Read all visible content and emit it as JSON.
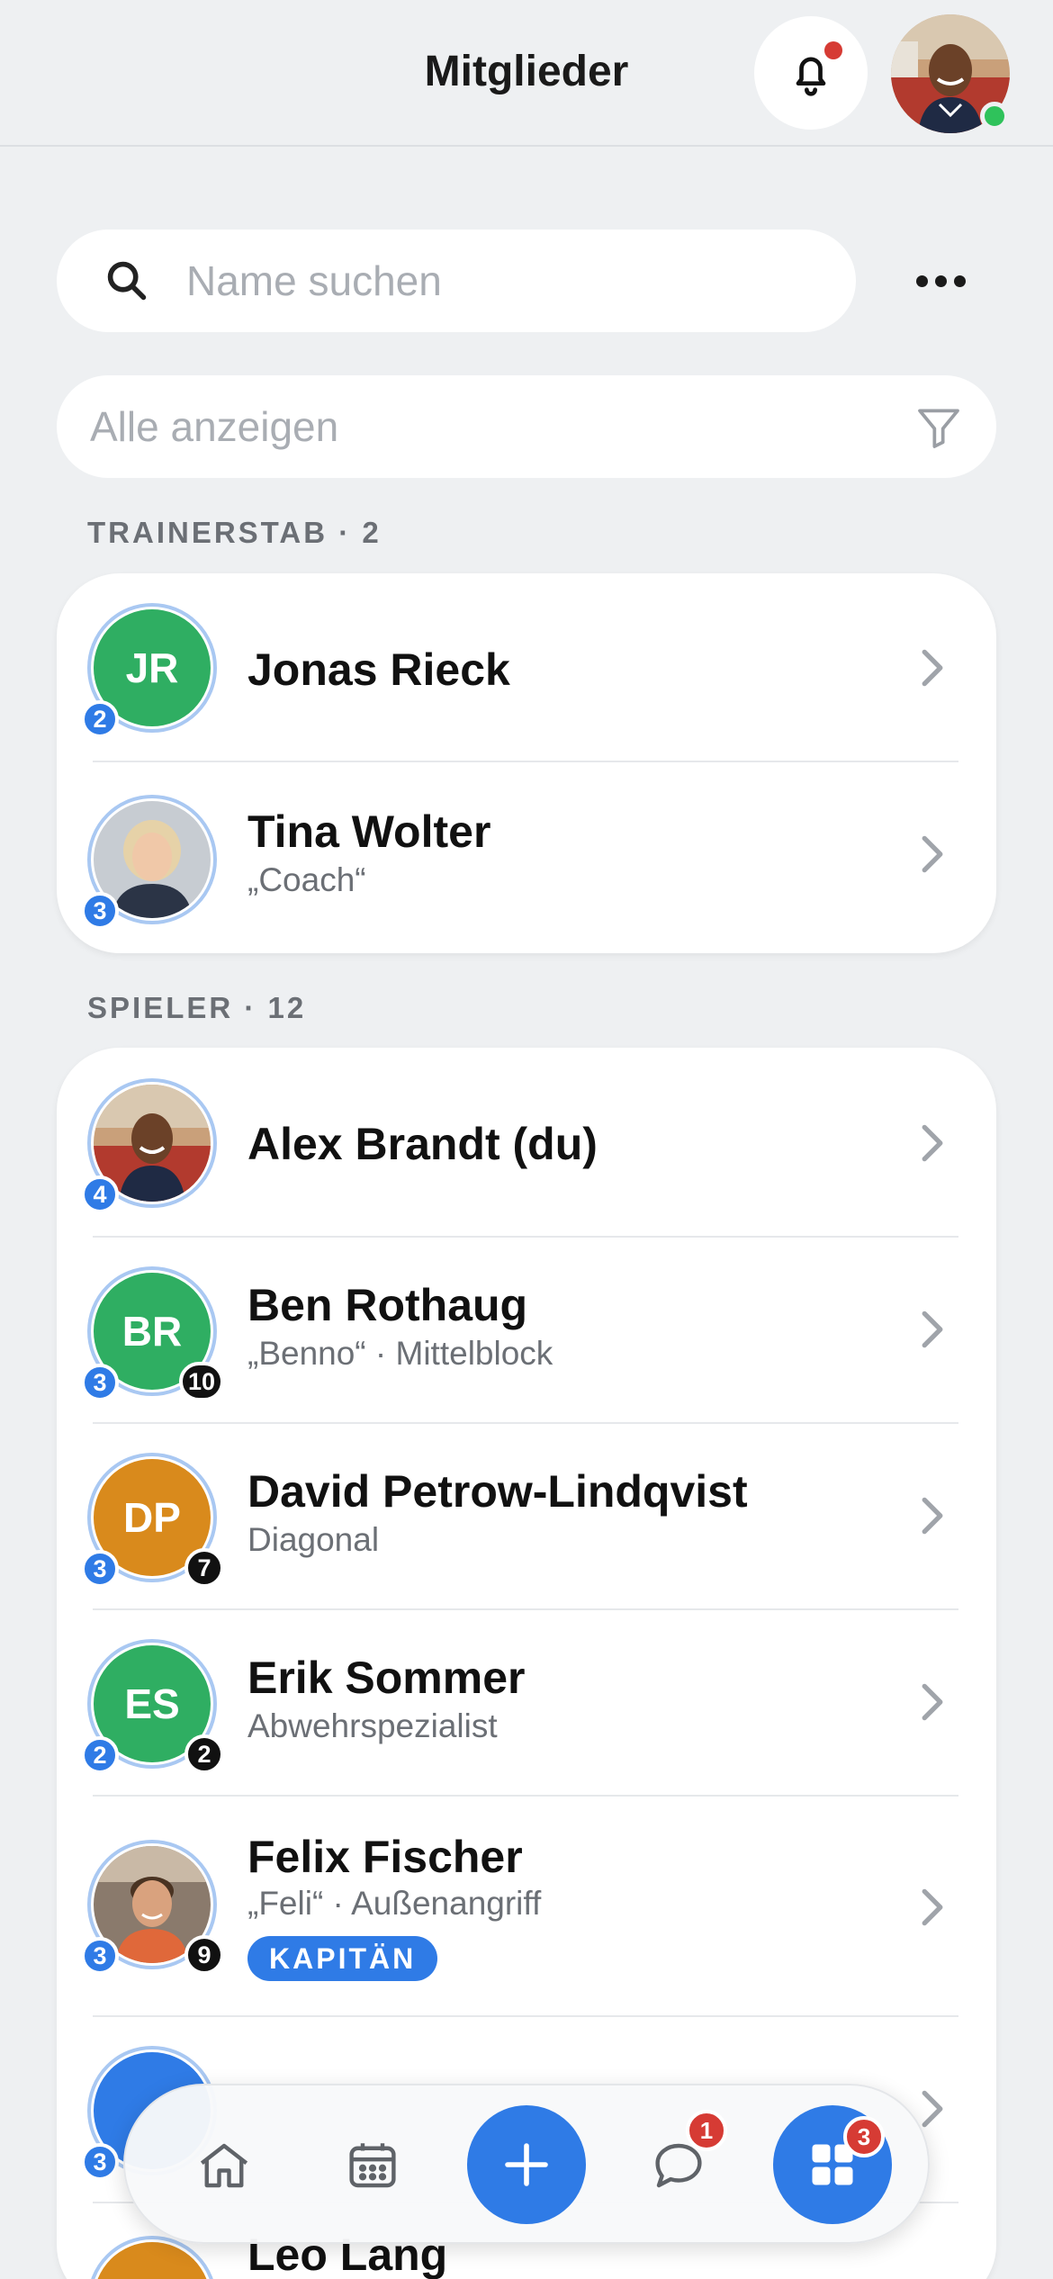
{
  "header": {
    "title": "Mitglieder",
    "bell_icon": "bell-icon",
    "notification_dot_color": "#d63b34",
    "online_status_color": "#2fc25b"
  },
  "search": {
    "placeholder": "Name suchen",
    "value": ""
  },
  "filter": {
    "label": "Alle anzeigen"
  },
  "sections": {
    "staff": {
      "label": "TRAINERSTAB · 2",
      "members": [
        {
          "name": "Jonas Rieck",
          "sub": "",
          "initials": "JR",
          "color": "#2fae62",
          "level": "2"
        },
        {
          "name": "Tina Wolter",
          "sub": "„Coach“",
          "initials": "",
          "color": "",
          "level": "3"
        }
      ]
    },
    "players": {
      "label": "SPIELER · 12",
      "members": [
        {
          "name": "Alex Brandt (du)",
          "sub": "",
          "initials": "",
          "level": "4"
        },
        {
          "name": "Ben Rothaug",
          "sub": "„Benno“ · Mittelblock",
          "initials": "BR",
          "color": "#2fae62",
          "level": "3",
          "number": "10"
        },
        {
          "name": "David Petrow-Lindqvist",
          "sub": "Diagonal",
          "initials": "DP",
          "color": "#d98a1c",
          "level": "3",
          "number": "7"
        },
        {
          "name": "Erik Sommer",
          "sub": "Abwehrspezialist",
          "initials": "ES",
          "color": "#2fae62",
          "level": "2",
          "number": "2"
        },
        {
          "name": "Felix Fischer",
          "sub": "„Feli“ · Außenangriff",
          "initials": "",
          "level": "3",
          "number": "9",
          "tag": "KAPITÄN"
        },
        {
          "name": "Leo Lang",
          "sub": "",
          "initials": "",
          "level": ""
        }
      ]
    }
  },
  "partial_row": {
    "level": "3"
  },
  "bottom_nav": {
    "chat_badge": "1",
    "apps_badge": "3"
  },
  "accent_color": "#2f7be6"
}
